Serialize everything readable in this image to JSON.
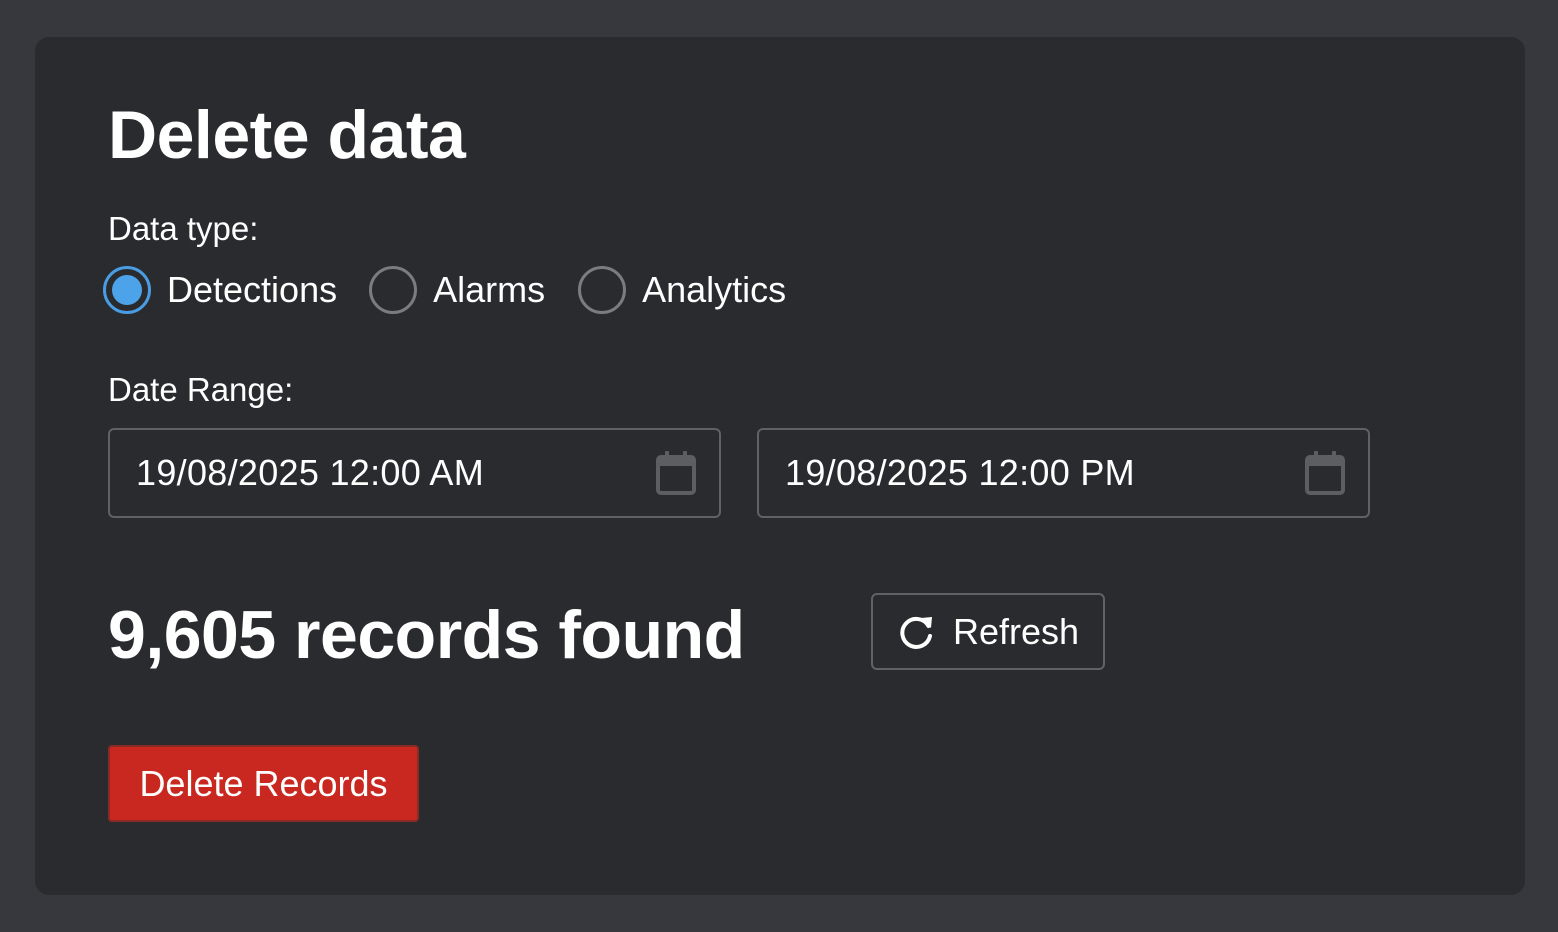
{
  "card": {
    "title": "Delete data"
  },
  "data_type": {
    "label": "Data type:",
    "options": [
      {
        "label": "Detections",
        "selected": true
      },
      {
        "label": "Alarms",
        "selected": false
      },
      {
        "label": "Analytics",
        "selected": false
      }
    ]
  },
  "date_range": {
    "label": "Date Range:",
    "start": "19/08/2025 12:00 AM",
    "end": "19/08/2025 12:00 PM",
    "icon": "calendar-icon"
  },
  "records": {
    "text": "9,605 records found"
  },
  "refresh": {
    "label": "Refresh",
    "icon": "refresh-icon"
  },
  "delete": {
    "label": "Delete Records",
    "color": "#c8281f"
  },
  "colors": {
    "page_background": "#36383d",
    "card_background": "#2a2b2f",
    "radio_accent": "#4da3ea"
  }
}
